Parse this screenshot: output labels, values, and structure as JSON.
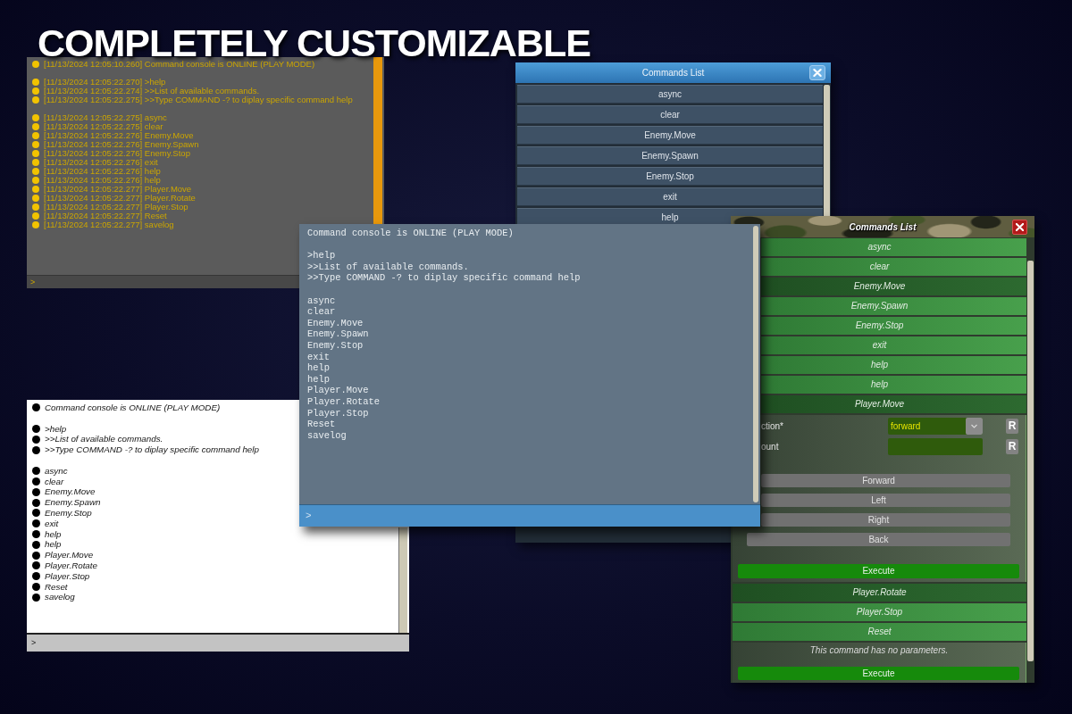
{
  "headline": "COMPLETELY CUSTOMIZABLE",
  "consoles": [
    {
      "kind": "amber",
      "groups": [
        [
          "[11/13/2024 12:05:10.260] Command console is ONLINE (PLAY MODE)"
        ],
        [
          "[11/13/2024 12:05:22.270] >help",
          "[11/13/2024 12:05:22.274] >>List of available commands.",
          "[11/13/2024 12:05:22.275] >>Type COMMAND -? to diplay specific command help"
        ],
        [
          "[11/13/2024 12:05:22.275] async",
          "[11/13/2024 12:05:22.275] clear",
          "[11/13/2024 12:05:22.276] Enemy.Move",
          "[11/13/2024 12:05:22.276] Enemy.Spawn",
          "[11/13/2024 12:05:22.276] Enemy.Stop",
          "[11/13/2024 12:05:22.276] exit",
          "[11/13/2024 12:05:22.276] help",
          "[11/13/2024 12:05:22.276] help",
          "[11/13/2024 12:05:22.277] Player.Move",
          "[11/13/2024 12:05:22.277] Player.Rotate",
          "[11/13/2024 12:05:22.277] Player.Stop",
          "[11/13/2024 12:05:22.277] Reset",
          "[11/13/2024 12:05:22.277] savelog"
        ]
      ],
      "prompt": ">"
    },
    {
      "kind": "slate",
      "groups": [
        [
          "Command console is ONLINE (PLAY MODE)"
        ],
        [
          ">help",
          ">>List of available commands.",
          ">>Type COMMAND -? to diplay specific command help"
        ],
        [
          "async",
          "clear",
          "Enemy.Move",
          "Enemy.Spawn",
          "Enemy.Stop",
          "exit",
          "help",
          "help",
          "Player.Move",
          "Player.Rotate",
          "Player.Stop",
          "Reset",
          "savelog"
        ]
      ],
      "prompt": ">"
    },
    {
      "kind": "light",
      "groups": [
        [
          "Command console is ONLINE (PLAY MODE)"
        ],
        [
          ">help",
          ">>List of available commands.",
          ">>Type COMMAND -? to diplay specific command help"
        ],
        [
          "async",
          "clear",
          "Enemy.Move",
          "Enemy.Spawn",
          "Enemy.Stop",
          "exit",
          "help",
          "help",
          "Player.Move",
          "Player.Rotate",
          "Player.Stop",
          "Reset",
          "savelog"
        ]
      ],
      "prompt": ">"
    }
  ],
  "command_lists": [
    {
      "kind": "blue",
      "title": "Commands List",
      "items": [
        {
          "label": "async"
        },
        {
          "label": "clear"
        },
        {
          "label": "Enemy.Move"
        },
        {
          "label": "Enemy.Spawn"
        },
        {
          "label": "Enemy.Stop"
        },
        {
          "label": "exit"
        },
        {
          "label": "help"
        }
      ]
    },
    {
      "kind": "camouflage",
      "title": "Commands List",
      "items": [
        {
          "label": "async",
          "highlighted": false
        },
        {
          "label": "clear",
          "highlighted": false
        },
        {
          "label": "Enemy.Move",
          "highlighted": true
        },
        {
          "label": "Enemy.Spawn",
          "highlighted": false
        },
        {
          "label": "Enemy.Stop",
          "highlighted": false
        },
        {
          "label": "exit",
          "highlighted": false
        },
        {
          "label": "help",
          "highlighted": false
        },
        {
          "label": "help",
          "highlighted": false
        },
        {
          "label": "Player.Move",
          "highlighted": true,
          "panel": {
            "params": [
              {
                "label": "ction*",
                "kind": "dropdown",
                "value": "forward",
                "reset": "R"
              },
              {
                "label": "ount",
                "kind": "text",
                "reset": "R"
              }
            ],
            "options": [
              "Forward",
              "Left",
              "Right",
              "Back"
            ],
            "execute": "Execute"
          }
        },
        {
          "label": "Player.Rotate",
          "highlighted": true
        },
        {
          "label": "Player.Stop",
          "highlighted": false
        },
        {
          "label": "Reset",
          "highlighted": false,
          "panel": {
            "message": "This command has no parameters.",
            "execute": "Execute"
          }
        }
      ]
    }
  ]
}
